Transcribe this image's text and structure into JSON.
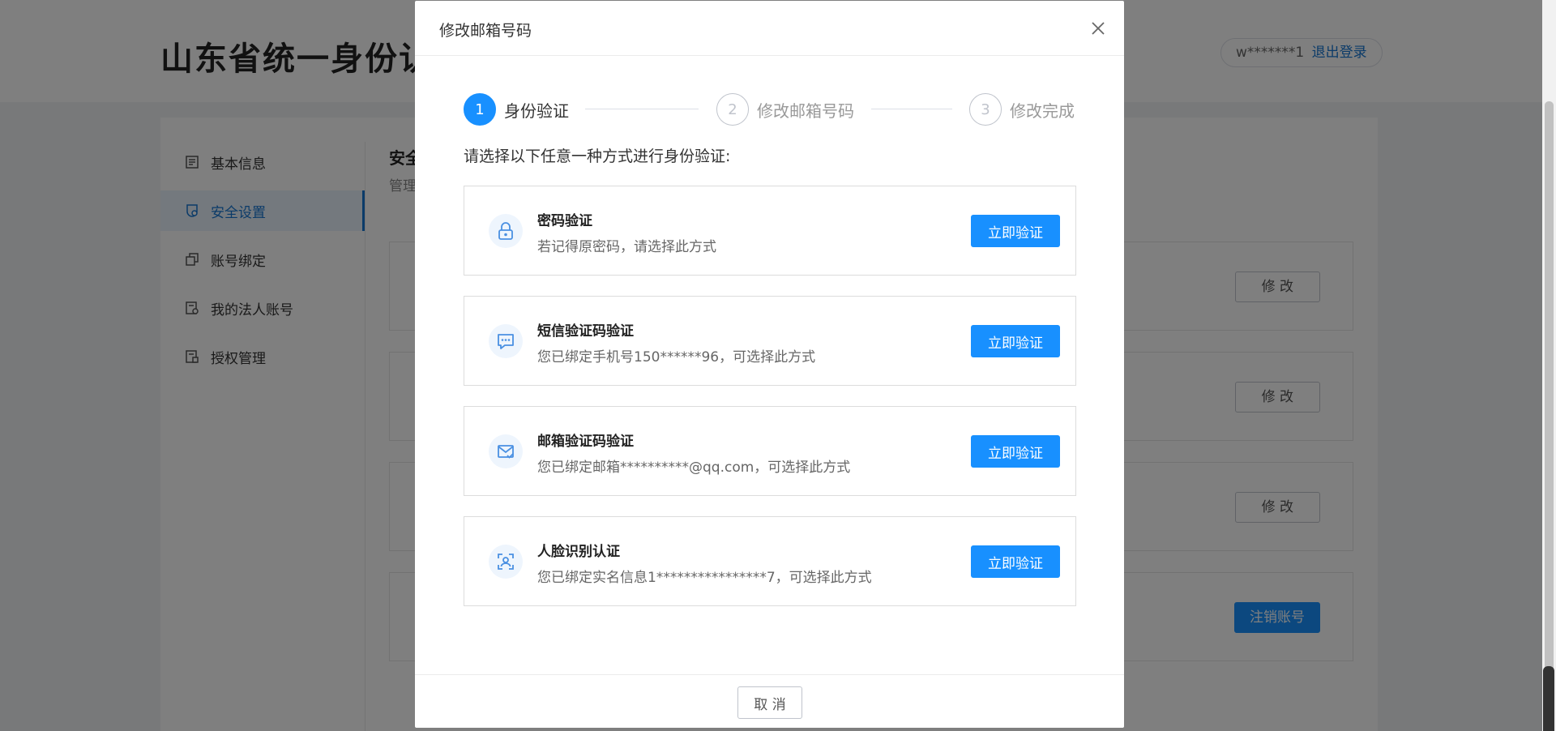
{
  "header": {
    "site_title": "山东省统一身份认证",
    "username": "w*******1",
    "logout_label": "退出登录"
  },
  "sidebar": {
    "items": [
      {
        "label": "基本信息",
        "icon": "document-icon",
        "active": false
      },
      {
        "label": "安全设置",
        "icon": "shield-icon",
        "active": true
      },
      {
        "label": "账号绑定",
        "icon": "link-icon",
        "active": false
      },
      {
        "label": "我的法人账号",
        "icon": "company-icon",
        "active": false
      },
      {
        "label": "授权管理",
        "icon": "authorize-icon",
        "active": false
      }
    ]
  },
  "security": {
    "title": "安全",
    "subtitle": "管理",
    "cards": [
      {
        "button_label": "修 改"
      },
      {
        "button_label": "修 改"
      },
      {
        "button_label": "修 改"
      },
      {
        "button_label": "注销账号"
      }
    ]
  },
  "modal": {
    "title": "修改邮箱号码",
    "close_icon": "close-icon",
    "steps": [
      {
        "number": "1",
        "label": "身份验证",
        "active": true
      },
      {
        "number": "2",
        "label": "修改邮箱号码",
        "active": false
      },
      {
        "number": "3",
        "label": "修改完成",
        "active": false
      }
    ],
    "prompt": "请选择以下任意一种方式进行身份验证:",
    "methods": [
      {
        "title": "密码验证",
        "desc": "若记得原密码，请选择此方式",
        "button_label": "立即验证",
        "icon": "lock-icon"
      },
      {
        "title": "短信验证码验证",
        "desc": "您已绑定手机号150******96，可选择此方式",
        "button_label": "立即验证",
        "icon": "message-icon"
      },
      {
        "title": "邮箱验证码验证",
        "desc": "您已绑定邮箱**********@qq.com，可选择此方式",
        "button_label": "立即验证",
        "icon": "mail-icon"
      },
      {
        "title": "人脸识别认证",
        "desc": "您已绑定实名信息1****************7，可选择此方式",
        "button_label": "立即验证",
        "icon": "face-scan-icon"
      }
    ],
    "cancel_label": "取 消"
  },
  "colors": {
    "primary": "#1890ff",
    "link": "#1677d2",
    "overlay": "rgba(0,0,0,0.5)"
  }
}
